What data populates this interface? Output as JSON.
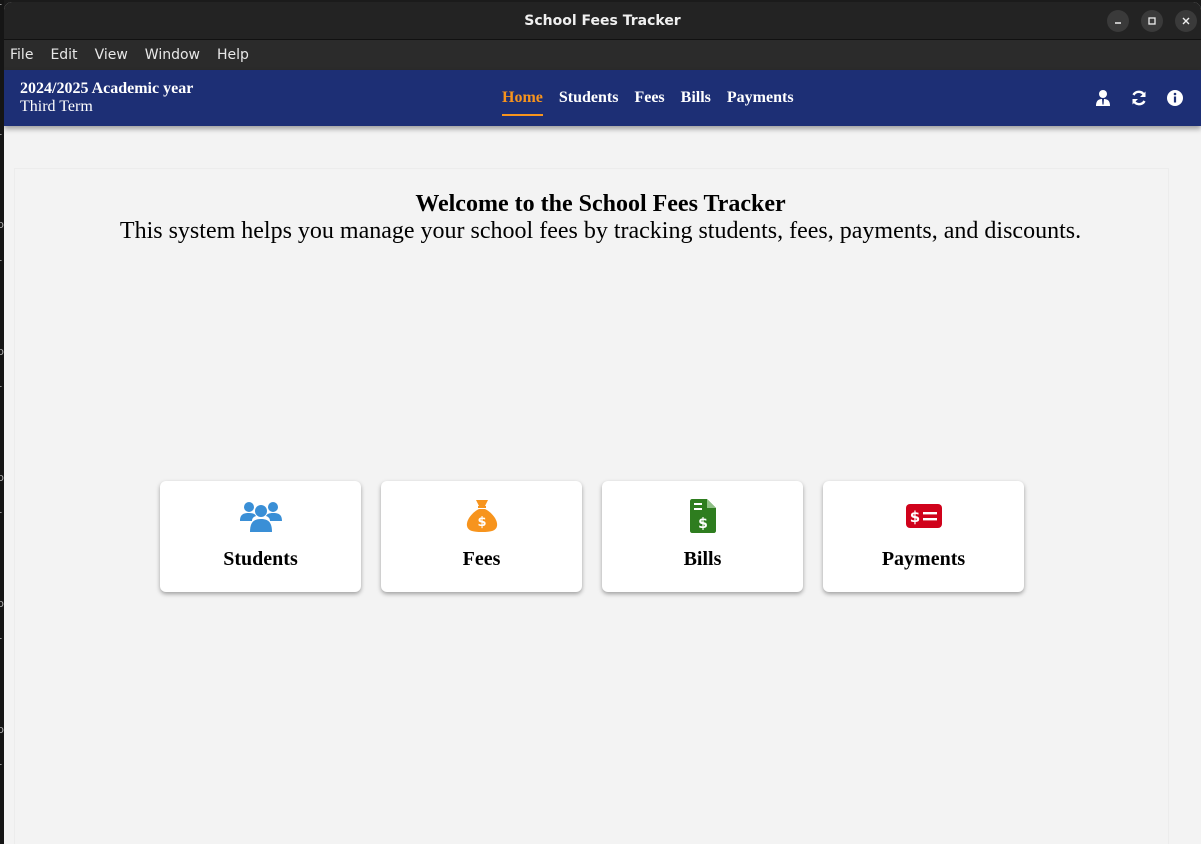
{
  "window": {
    "title": "School Fees Tracker"
  },
  "menubar": [
    "File",
    "Edit",
    "View",
    "Window",
    "Help"
  ],
  "header": {
    "academic_year": "2024/2025 Academic year",
    "term": "Third Term",
    "tabs": [
      {
        "label": "Home",
        "active": true
      },
      {
        "label": "Students",
        "active": false
      },
      {
        "label": "Fees",
        "active": false
      },
      {
        "label": "Bills",
        "active": false
      },
      {
        "label": "Payments",
        "active": false
      }
    ],
    "actions": [
      "user-icon",
      "refresh-icon",
      "info-icon"
    ]
  },
  "main": {
    "heading": "Welcome to the School Fees Tracker",
    "subtitle": "This system helps you manage your school fees by tracking students, fees, payments, and discounts.",
    "cards": [
      {
        "label": "Students",
        "icon": "users-icon",
        "color": "#3a8fd6"
      },
      {
        "label": "Fees",
        "icon": "money-bag-icon",
        "color": "#f7941d"
      },
      {
        "label": "Bills",
        "icon": "invoice-icon",
        "color": "#2e7d1f"
      },
      {
        "label": "Payments",
        "icon": "money-bill-icon",
        "color": "#d0021b"
      }
    ]
  },
  "colors": {
    "appbar": "#1d2f75",
    "accent": "#f7941d"
  }
}
